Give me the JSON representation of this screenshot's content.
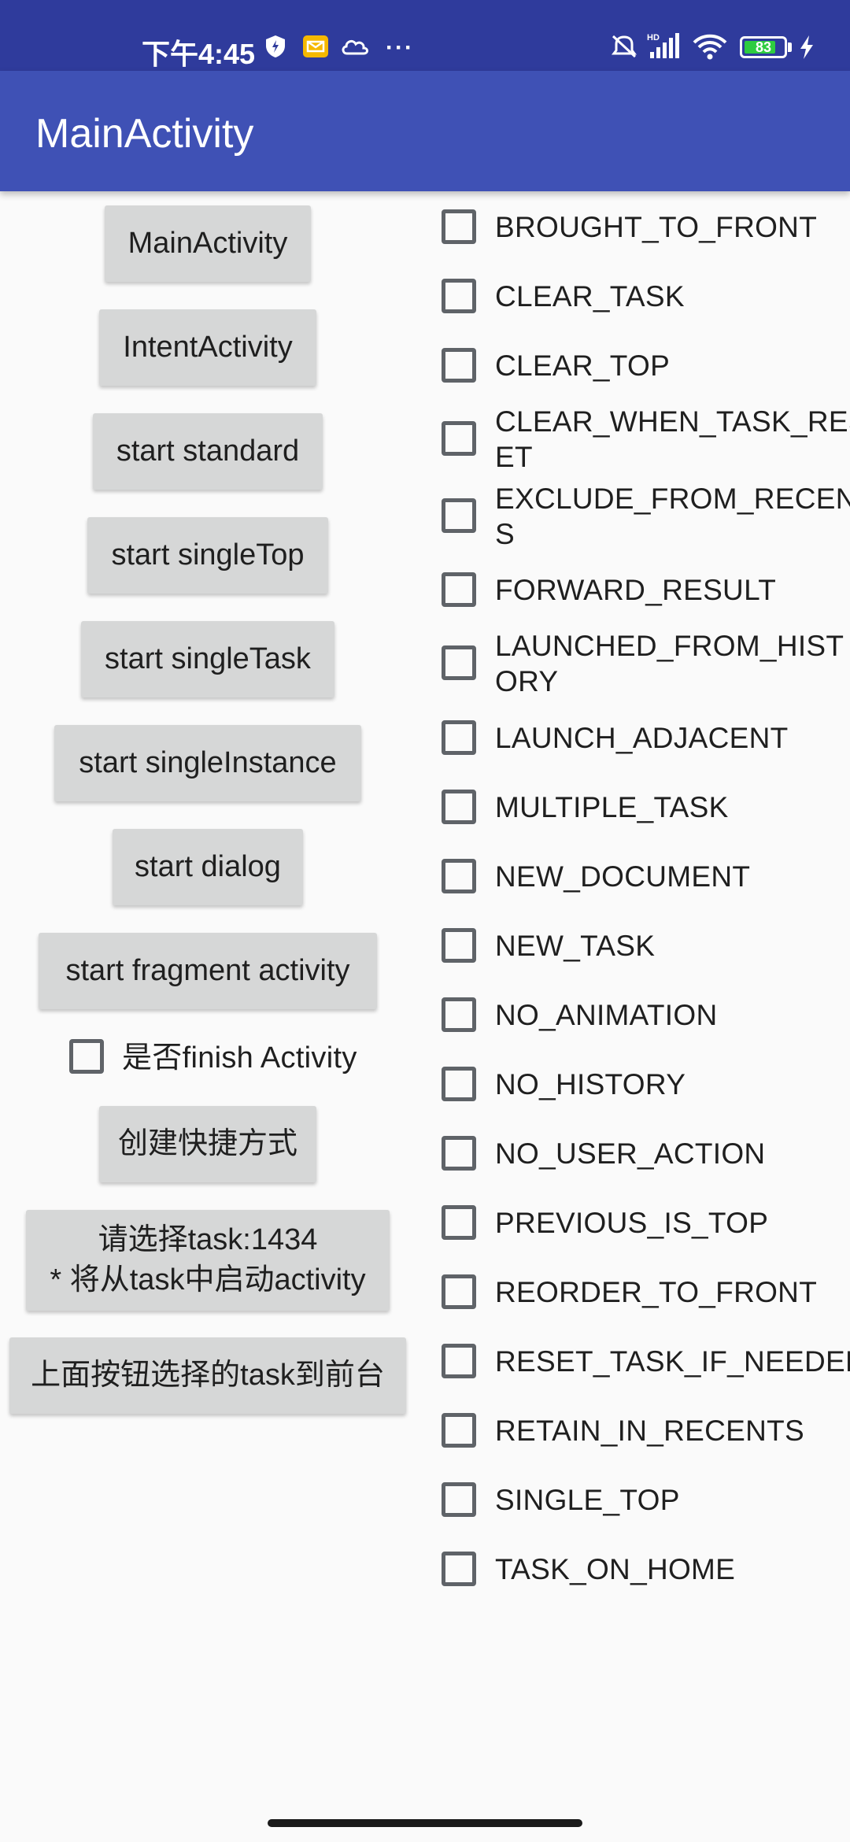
{
  "status_bar": {
    "time": "下午4:45",
    "battery": "83",
    "icons": [
      "shield-icon",
      "mail-icon",
      "cloud-icon",
      "more-icon",
      "mute-icon",
      "hd-signal-icon",
      "wifi-icon",
      "battery-icon",
      "charging-icon"
    ]
  },
  "app_bar": {
    "title": "MainActivity"
  },
  "buttons": {
    "main_activity": "MainActivity",
    "intent_activity": "IntentActivity",
    "start_standard": "start standard",
    "start_single_top": "start singleTop",
    "start_single_task": "start singleTask",
    "start_single_instance": "start singleInstance",
    "start_dialog": "start dialog",
    "start_fragment_activity": "start fragment activity",
    "create_shortcut": "创建快捷方式",
    "select_task_line1": "请选择task:1434",
    "select_task_line2": "* 将从task中启动activity",
    "bring_task_front": "上面按钮选择的task到前台"
  },
  "finish_checkbox": {
    "label": "是否finish Activity",
    "checked": false
  },
  "flags": [
    {
      "label": "BROUGHT_TO_FRONT",
      "checked": false
    },
    {
      "label": "CLEAR_TASK",
      "checked": false
    },
    {
      "label": "CLEAR_TOP",
      "checked": false
    },
    {
      "label": "CLEAR_WHEN_TASK_RES",
      "label2": "ET",
      "checked": false
    },
    {
      "label": "EXCLUDE_FROM_RECENT",
      "label2": "S",
      "checked": false
    },
    {
      "label": "FORWARD_RESULT",
      "checked": false
    },
    {
      "label": "LAUNCHED_FROM_HIST",
      "label2": "ORY",
      "checked": false
    },
    {
      "label": "LAUNCH_ADJACENT",
      "checked": false
    },
    {
      "label": "MULTIPLE_TASK",
      "checked": false
    },
    {
      "label": "NEW_DOCUMENT",
      "checked": false
    },
    {
      "label": "NEW_TASK",
      "checked": false
    },
    {
      "label": "NO_ANIMATION",
      "checked": false
    },
    {
      "label": "NO_HISTORY",
      "checked": false
    },
    {
      "label": "NO_USER_ACTION",
      "checked": false
    },
    {
      "label": "PREVIOUS_IS_TOP",
      "checked": false
    },
    {
      "label": "REORDER_TO_FRONT",
      "checked": false
    },
    {
      "label": "RESET_TASK_IF_NEEDED",
      "checked": false
    },
    {
      "label": "RETAIN_IN_RECENTS",
      "checked": false
    },
    {
      "label": "SINGLE_TOP",
      "checked": false
    },
    {
      "label": "TASK_ON_HOME",
      "checked": false
    }
  ],
  "colors": {
    "status_bar": "#2f3b9c",
    "app_bar": "#3f51b5",
    "button_bg": "#d6d7d7",
    "background": "#fafafa",
    "checkbox_border": "#5f6368"
  }
}
